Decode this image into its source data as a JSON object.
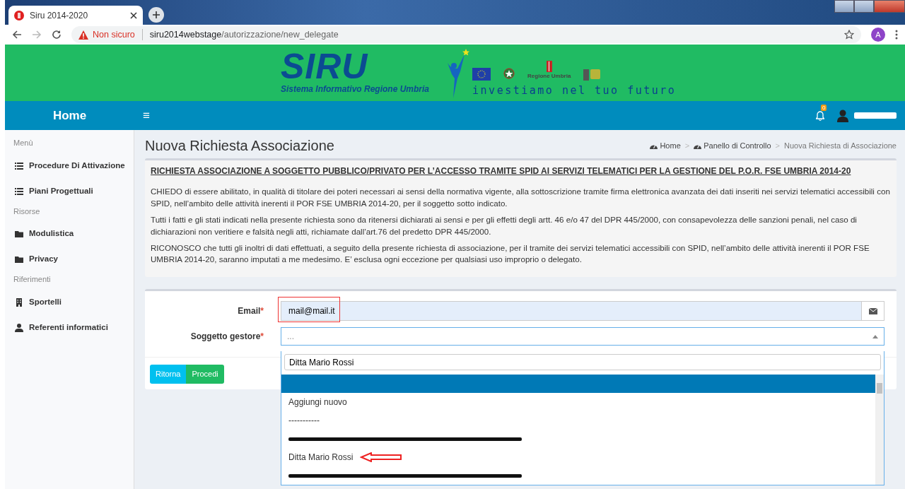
{
  "browser": {
    "tab_title": "Siru 2014-2020",
    "security": "Non sicuro",
    "url_host": "siru2014webstage",
    "url_path": "/autorizzazione/new_delegate",
    "profile_initial": "A"
  },
  "banner": {
    "logo_title": "SIRU",
    "logo_subtitle": "Sistema Informativo Regione Umbria",
    "region_label": "Regione Umbria",
    "slogan": "investiamo nel tuo futuro"
  },
  "navbar": {
    "brand": "Home",
    "menu_glyph": "≡",
    "notification_count": "0",
    "user_redacted": true
  },
  "sidebar": {
    "sections": [
      {
        "heading": "Menù",
        "items": [
          {
            "label": "Procedure Di Attivazione",
            "kind": "list"
          },
          {
            "label": "Piani Progettuali",
            "kind": "list"
          }
        ]
      },
      {
        "heading": "Risorse",
        "items": [
          {
            "label": "Modulistica",
            "kind": "folder"
          },
          {
            "label": "Privacy",
            "kind": "folder"
          }
        ]
      },
      {
        "heading": "Riferimenti",
        "items": [
          {
            "label": "Sportelli",
            "kind": "building"
          },
          {
            "label": "Referenti informatici",
            "kind": "user"
          }
        ]
      }
    ]
  },
  "page": {
    "title": "Nuova Richiesta Associazione",
    "breadcrumb": [
      {
        "label": "Home",
        "kind": "link"
      },
      {
        "separator": ">",
        "label": "Panello di Controllo",
        "kind": "link"
      },
      {
        "separator": ">",
        "label": "Nuova Richiesta di Associazione",
        "kind": "current"
      }
    ]
  },
  "notice": {
    "heading": "RICHIESTA ASSOCIAZIONE A SOGGETTO PUBBLICO/PRIVATO PER L’ACCESSO TRAMITE SPID AI SERVIZI TELEMATICI PER LA GESTIONE DEL P.O.R. FSE UMBRIA 2014-20",
    "paragraphs": [
      "CHIEDO di essere abilitato, in qualità di titolare dei poteri necessari ai sensi della normativa vigente, alla sottoscrizione tramite firma elettronica avanzata dei dati inseriti nei servizi telematici accessibili con SPID, nell’ambito delle attività inerenti il POR FSE UMBRIA 2014-20, per il soggetto sotto indicato.",
      "Tutti i fatti e gli stati indicati nella presente richiesta sono da ritenersi dichiarati ai sensi e per gli effetti degli artt. 46 e/o 47 del DPR 445/2000, con consapevolezza delle sanzioni penali, nel caso di dichiarazioni non veritiere e falsità negli atti, richiamate dall’art.76 del predetto DPR 445/2000.",
      "RICONOSCO che tutti gli inoltri di dati effettuati, a seguito della presente richiesta di associazione, per il tramite dei servizi telematici accessibili con SPID, nell’ambito delle attività inerenti il POR FSE UMBRIA 2014-20, saranno imputati a me medesimo. E’ esclusa ogni eccezione per qualsiasi uso improprio o delegato."
    ]
  },
  "form": {
    "fields": [
      {
        "kind": "email",
        "label": "Email",
        "required_mark": "*",
        "value": "mail@mail.it",
        "highlighted": true
      },
      {
        "kind": "select",
        "label": "Soggetto gestore",
        "required_mark": "*",
        "placeholder": "...",
        "expanded": true,
        "search": "Ditta Mario Rossi",
        "options": [
          {
            "kind": "blank",
            "selected": true
          },
          {
            "kind": "text",
            "label": "Aggiungi nuovo",
            "selected": false
          },
          {
            "kind": "text",
            "label": "-----------",
            "selected": false
          },
          {
            "kind": "redacted",
            "selected": false
          },
          {
            "kind": "text",
            "label": "Ditta Mario Rossi",
            "selected": false,
            "annotated": true
          },
          {
            "kind": "redacted",
            "selected": false
          }
        ]
      }
    ]
  },
  "buttons": [
    {
      "label": "Ritorna",
      "kind": "info"
    },
    {
      "label": "Procedi",
      "kind": "success"
    }
  ]
}
